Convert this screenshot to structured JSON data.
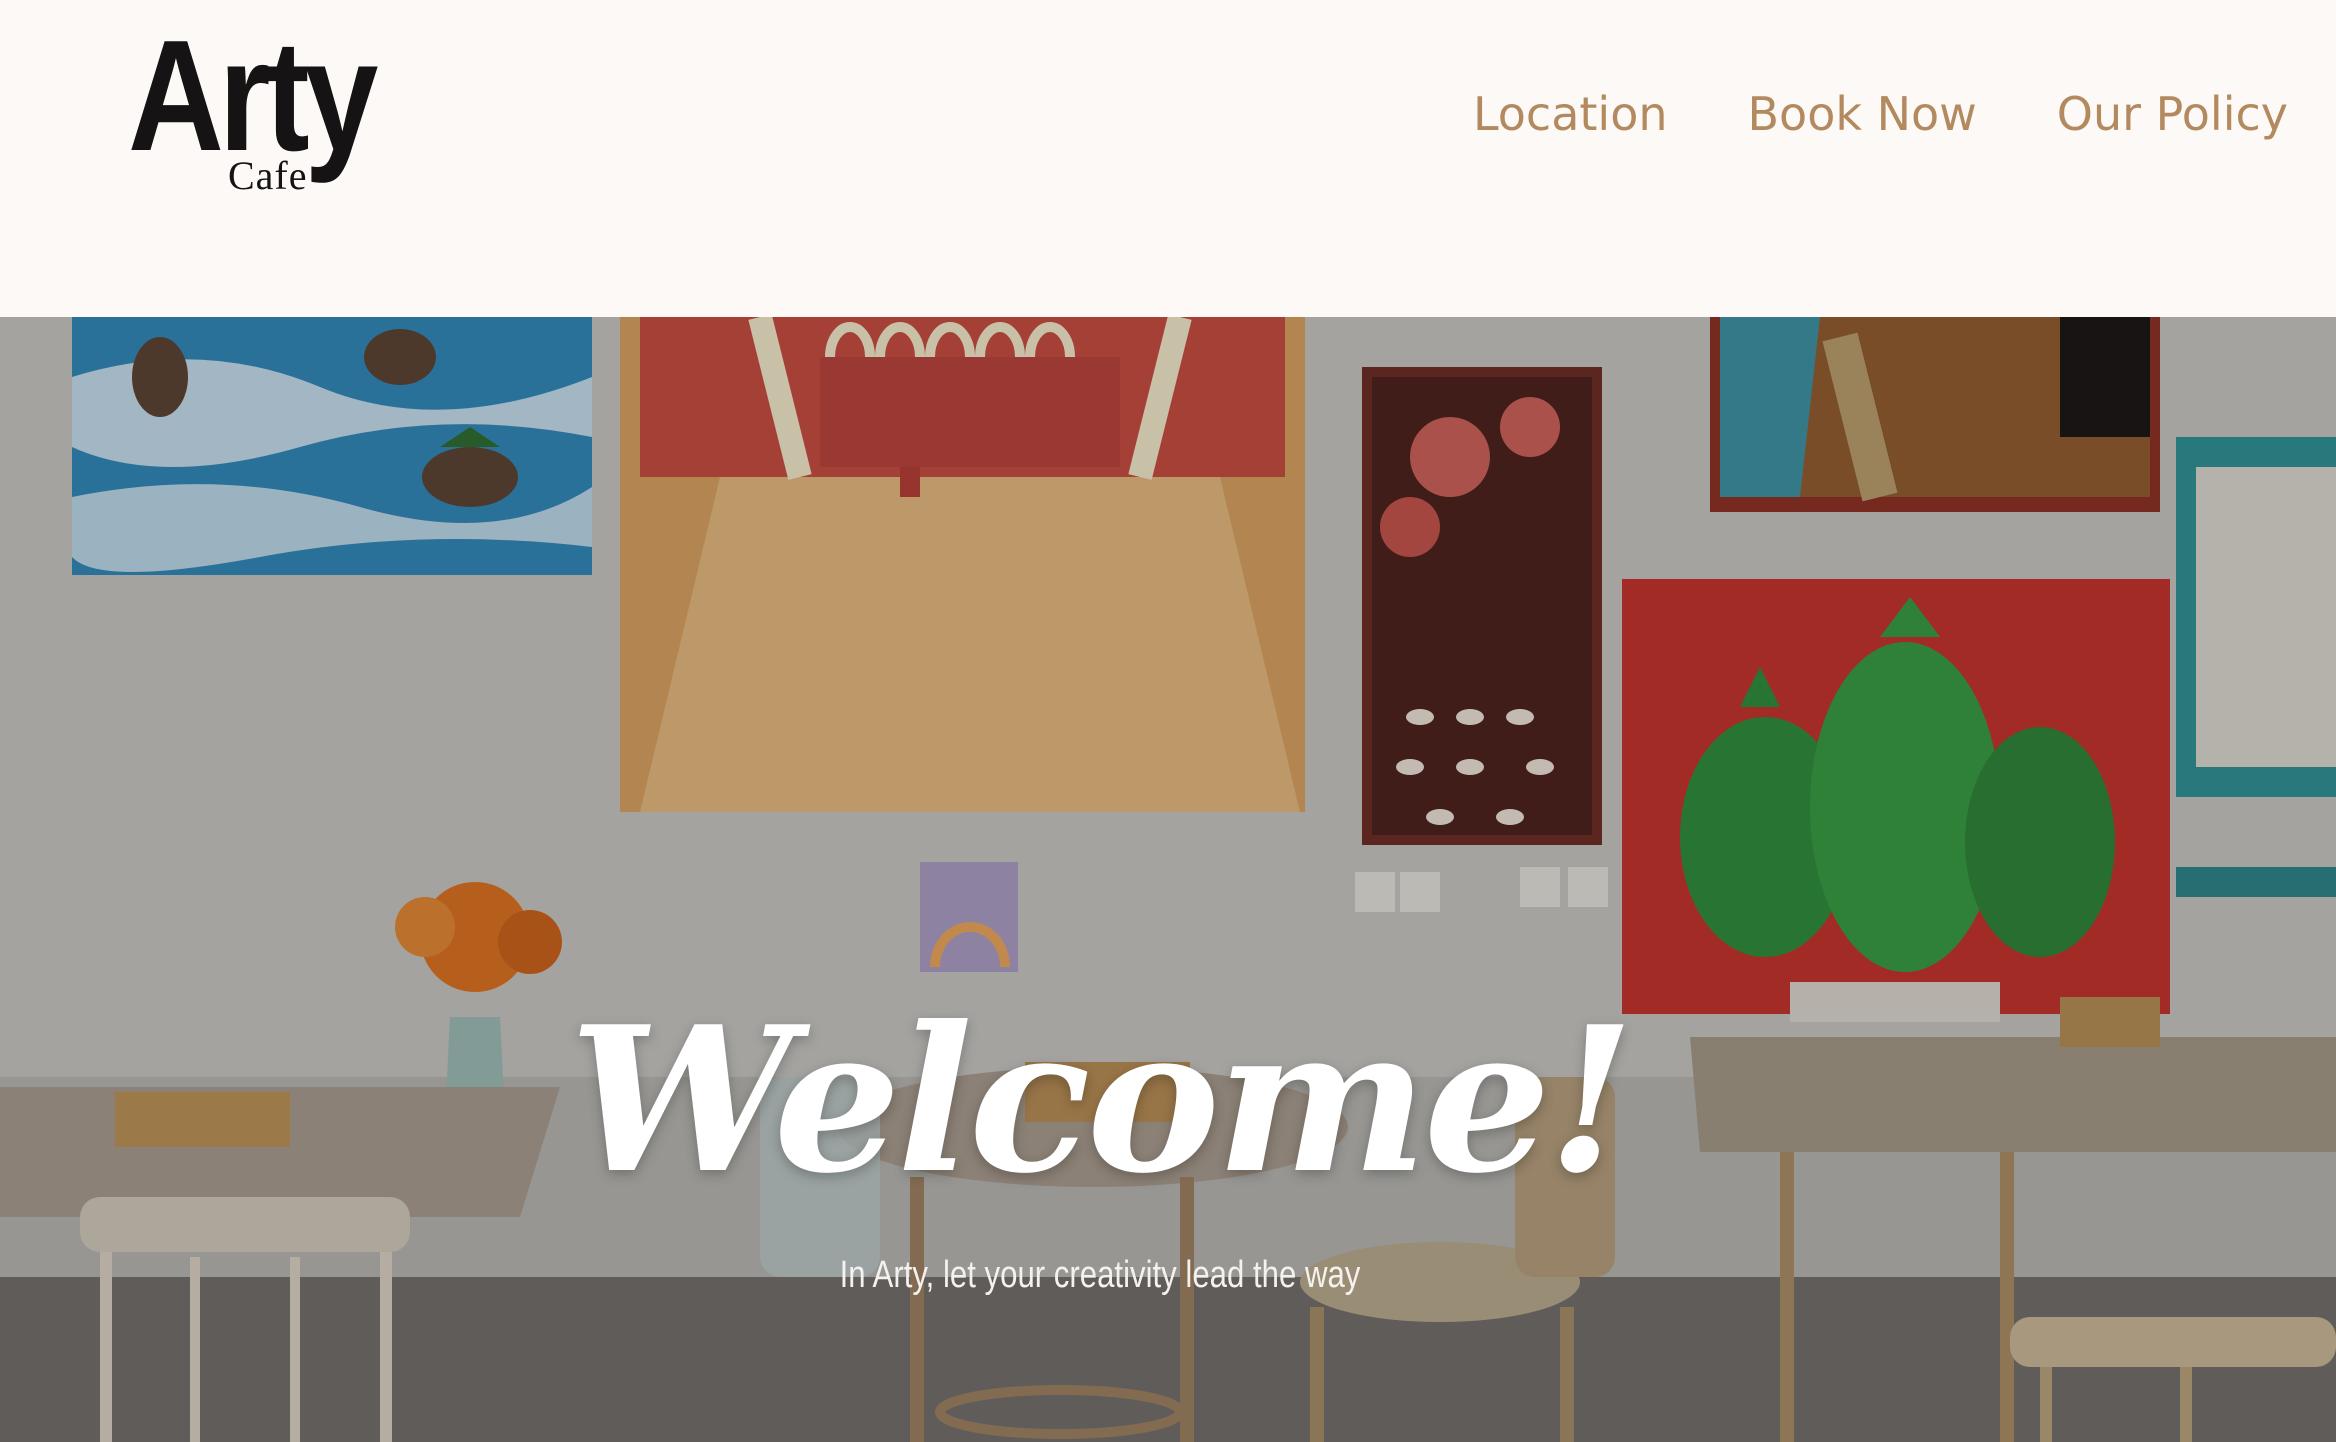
{
  "header": {
    "logo": {
      "main_text": "Arty",
      "sub_text": "Cafe"
    },
    "nav": [
      {
        "label": "Location"
      },
      {
        "label": "Book Now"
      },
      {
        "label": "Our Policy"
      }
    ]
  },
  "hero": {
    "title": "Welcome!",
    "subtitle": "In Arty, let your creativity lead the way",
    "background_image": "cafe-interior-photo"
  },
  "colors": {
    "header_background": "#fcf9f6",
    "nav_link": "#b38a5f",
    "logo": "#151313",
    "hero_text": "#ffffff"
  }
}
